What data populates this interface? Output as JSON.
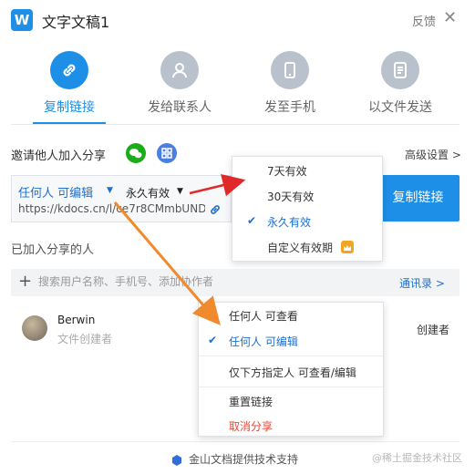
{
  "window": {
    "title": "文字文稿1",
    "feedback": "反馈",
    "logo_letter": "W"
  },
  "tabs": [
    {
      "label": "复制链接",
      "icon": "link-icon",
      "active": true
    },
    {
      "label": "发给联系人",
      "icon": "person-icon",
      "active": false
    },
    {
      "label": "发至手机",
      "icon": "phone-icon",
      "active": false
    },
    {
      "label": "以文件发送",
      "icon": "file-icon",
      "active": false
    }
  ],
  "invite": {
    "label": "邀请他人加入分享",
    "advanced": "高级设置 >"
  },
  "link": {
    "permission": "任何人 可编辑",
    "expiry": "永久有效",
    "url": "https://kdocs.cn/l/ce7r8CMmbUND",
    "copy_button": "复制链接"
  },
  "joined": {
    "label": "已加入分享的人"
  },
  "search": {
    "placeholder": "搜索用户名称、手机号、添加协作者",
    "contacts": "通讯录 >"
  },
  "member": {
    "name": "Berwin",
    "subtitle": "文件创建者",
    "role": "创建者"
  },
  "expiry_menu": {
    "items": [
      {
        "label": "7天有效",
        "selected": false
      },
      {
        "label": "30天有效",
        "selected": false
      },
      {
        "label": "永久有效",
        "selected": true
      },
      {
        "label": "自定义有效期",
        "selected": false,
        "badge": "crown-icon"
      }
    ]
  },
  "permission_menu": {
    "items": [
      {
        "label": "任何人 可查看",
        "selected": false
      },
      {
        "label": "任何人 可编辑",
        "selected": true
      },
      {
        "label": "仅下方指定人 可查看/编辑",
        "selected": false
      },
      {
        "label": "重置链接",
        "selected": false
      },
      {
        "label": "取消分享",
        "selected": false,
        "danger": true
      }
    ]
  },
  "footer": {
    "text": "金山文档提供技术支持"
  },
  "watermark": "@稀土掘金技术社区",
  "colors": {
    "accent": "#1e8fe6",
    "arrow_red": "#e02a2a",
    "arrow_orange": "#f08a2c"
  }
}
